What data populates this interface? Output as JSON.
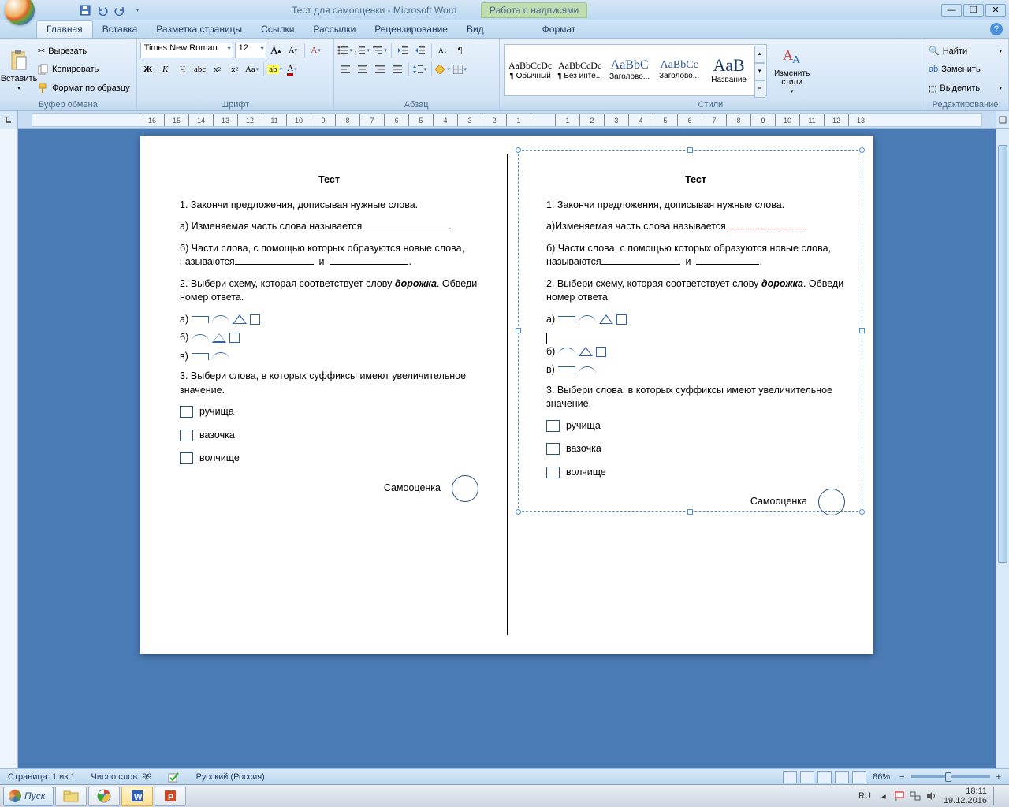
{
  "window": {
    "title": "Тест для самооценки - Microsoft Word",
    "context_tool": "Работа с надписями"
  },
  "tabs": {
    "home": "Главная",
    "insert": "Вставка",
    "layout": "Разметка страницы",
    "references": "Ссылки",
    "mailings": "Рассылки",
    "review": "Рецензирование",
    "view": "Вид",
    "format": "Формат"
  },
  "clipboard": {
    "paste": "Вставить",
    "cut": "Вырезать",
    "copy": "Копировать",
    "format_painter": "Формат по образцу",
    "group": "Буфер обмена"
  },
  "font": {
    "name": "Times New Roman",
    "size": "12",
    "group": "Шрифт"
  },
  "paragraph": {
    "group": "Абзац"
  },
  "styles": {
    "group": "Стили",
    "change": "Изменить стили",
    "items": [
      {
        "sample": "AaBbCcDc",
        "name": "¶ Обычный"
      },
      {
        "sample": "AaBbCcDc",
        "name": "¶ Без инте..."
      },
      {
        "sample": "AaBbC",
        "name": "Заголово..."
      },
      {
        "sample": "AaBbCc",
        "name": "Заголово..."
      },
      {
        "sample": "АаВ",
        "name": "Название"
      }
    ]
  },
  "editing": {
    "group": "Редактирование",
    "find": "Найти",
    "replace": "Заменить",
    "select": "Выделить"
  },
  "document": {
    "title": "Тест",
    "q1": "1. Закончи предложения, дописывая нужные слова.",
    "q1a_left": "а) Изменяемая часть слова  называется",
    "q1a_right": "а)Изменяемая часть слова  называется",
    "q1b": "б) Части слова, с помощью которых образуются новые слова, называются",
    "q1b_and": "и",
    "q2_pre": "2. Выбери схему, которая соответствует слову ",
    "q2_word": "дорожка",
    "q2_post": ". Обведи номер ответа.",
    "opt_a": "а)",
    "opt_b": "б)",
    "opt_v": "в)",
    "q3": "3. Выбери слова, в которых суффиксы имеют увеличительное значение.",
    "w1": "ручища",
    "w2": "вазочка",
    "w3": "волчище",
    "self": "Самооценка"
  },
  "status": {
    "page": "Страница: 1 из 1",
    "words": "Число слов: 99",
    "lang": "Русский (Россия)",
    "zoom": "86%"
  },
  "taskbar": {
    "start": "Пуск",
    "lang": "RU",
    "time": "18:11",
    "date": "19.12.2016"
  }
}
